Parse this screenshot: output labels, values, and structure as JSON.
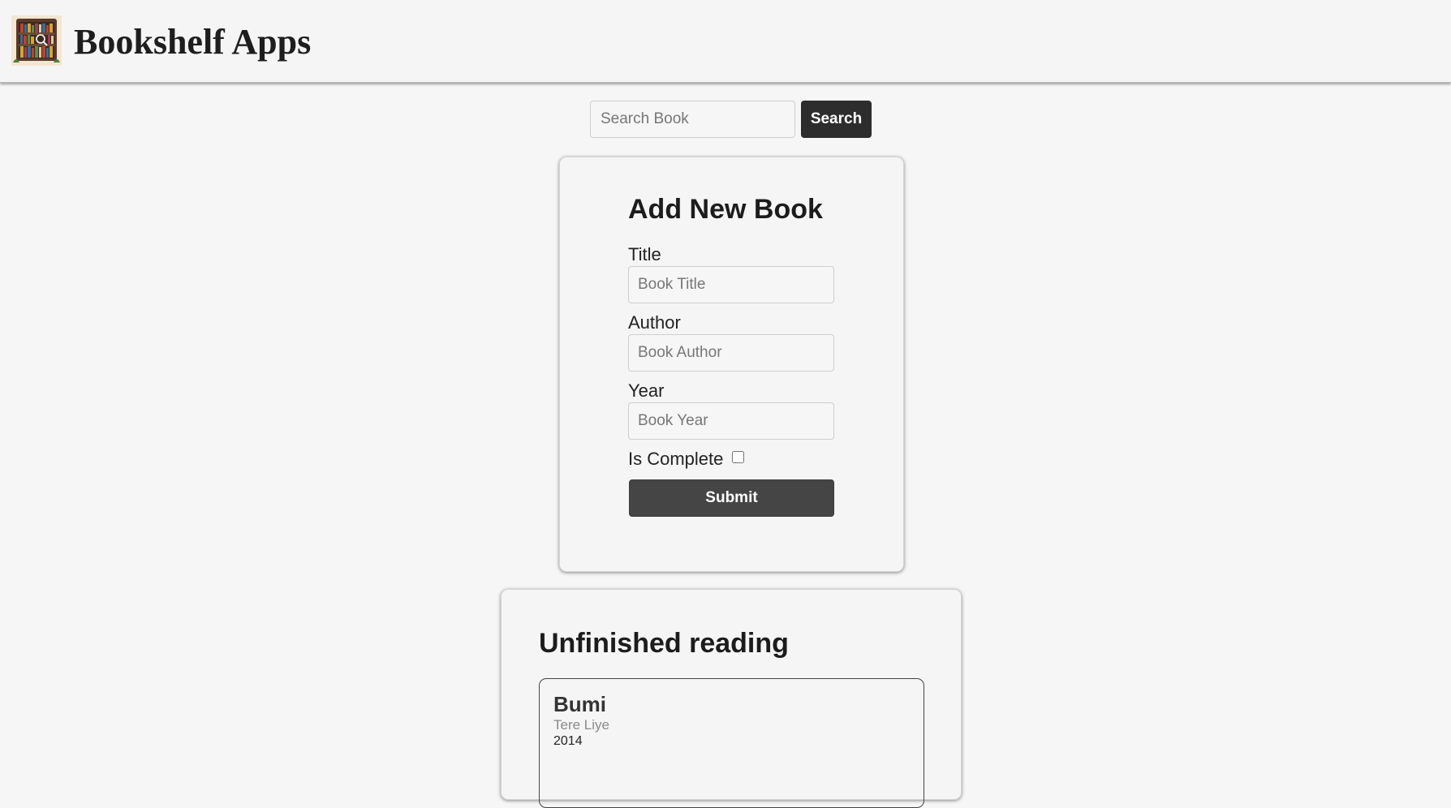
{
  "header": {
    "title": "Bookshelf Apps",
    "logo_icon": "bookshelf-icon"
  },
  "search": {
    "placeholder": "Search Book",
    "value": "",
    "button_label": "Search"
  },
  "form": {
    "heading": "Add New Book",
    "title_label": "Title",
    "title_placeholder": "Book Title",
    "author_label": "Author",
    "author_placeholder": "Book Author",
    "year_label": "Year",
    "year_placeholder": "Book Year",
    "complete_label": "Is Complete",
    "complete_checked": false,
    "submit_label": "Submit"
  },
  "unfinished": {
    "heading": "Unfinished reading",
    "books": [
      {
        "title": "Bumi",
        "author": "Tere Liye",
        "year": "2014"
      }
    ]
  },
  "colors": {
    "background": "#f6f6f6",
    "button_dark": "#2d2d2d",
    "submit": "#454545"
  }
}
